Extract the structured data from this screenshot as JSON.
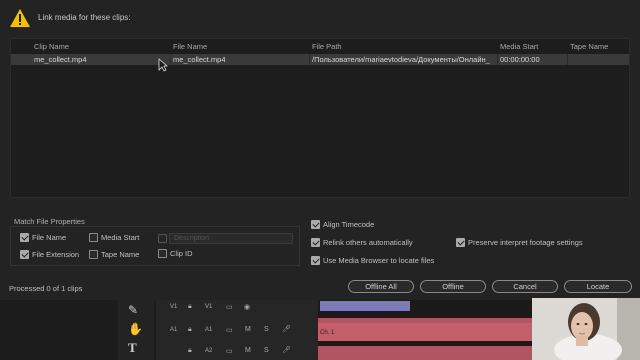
{
  "dialog": {
    "prompt": "Link media for these clips:",
    "columns": [
      "Clip Name",
      "File Name",
      "File Path",
      "Media Start",
      "Tape Name"
    ],
    "rows": [
      {
        "clip_name": "me_collect.mp4",
        "file_name": "me_collect.mp4",
        "file_path": "/Пользователи/mariaevtodieva/Документы/Онлайн_",
        "media_start": "00:00:00:00",
        "tape_name": ""
      }
    ],
    "match_group_title": "Match File Properties",
    "match_options": {
      "file_name": {
        "label": "File Name",
        "checked": true
      },
      "media_start": {
        "label": "Media Start",
        "checked": false
      },
      "description": {
        "label": "Description",
        "checked": false,
        "enabled": false
      },
      "file_extension": {
        "label": "File Extension",
        "checked": true
      },
      "tape_name": {
        "label": "Tape Name",
        "checked": false
      },
      "clip_id": {
        "label": "Clip ID",
        "checked": false
      }
    },
    "options": {
      "align_timecode": {
        "label": "Align Timecode",
        "checked": true
      },
      "relink_others": {
        "label": "Relink others automatically",
        "checked": true
      },
      "preserve_interpret": {
        "label": "Preserve interpret footage settings",
        "checked": true
      },
      "use_media_browser": {
        "label": "Use Media Browser to locate files",
        "checked": true
      }
    },
    "status": "Processed 0 of 1 clips",
    "buttons": {
      "offline_all": "Offline All",
      "offline": "Offline",
      "cancel": "Cancel",
      "locate": "Locate"
    }
  },
  "timeline": {
    "tracks": [
      {
        "src": "V1",
        "dst": "V1",
        "icons": [
          "lock",
          "clip",
          "eye"
        ]
      },
      {
        "src": "A1",
        "dst": "A1",
        "icons": [
          "lock",
          "clip",
          "M",
          "S",
          "mic"
        ]
      },
      {
        "src": "",
        "dst": "A2",
        "icons": [
          "lock",
          "clip",
          "M",
          "S",
          "mic"
        ]
      }
    ],
    "clip_label": "Ch. 1"
  },
  "colors": {
    "accent_warning": "#f2c200",
    "clip_red": "#b05561"
  }
}
